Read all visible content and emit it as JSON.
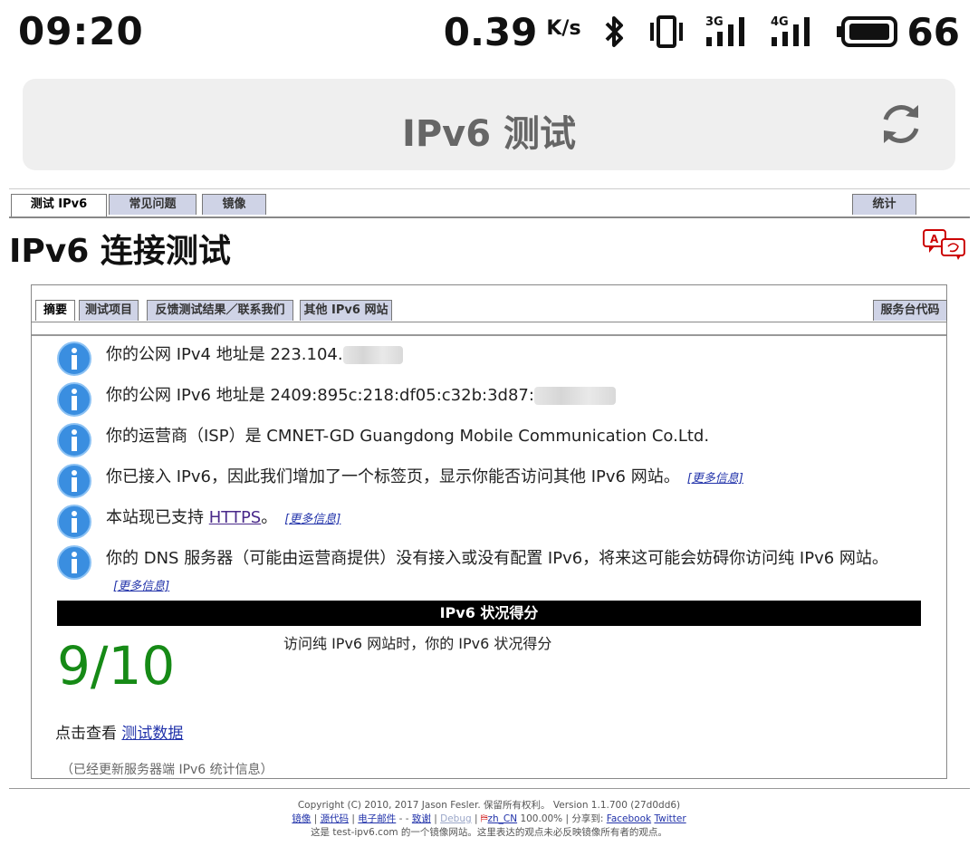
{
  "status_bar": {
    "time": "09:20",
    "speed": "0.39",
    "speed_unit": "K/s",
    "battery": "66",
    "icons": [
      "bluetooth-icon",
      "vibrate-icon",
      "signal-3g-icon",
      "signal-4g-icon",
      "battery-icon"
    ],
    "net_3g": "3G",
    "net_4g": "4G"
  },
  "browser": {
    "title": "IPv6 测试"
  },
  "top_tabs": {
    "test": "测试 IPv6",
    "faq": "常见问题",
    "mirror": "镜像",
    "stats": "统计"
  },
  "page": {
    "title": "IPv6 连接测试"
  },
  "inner_tabs": {
    "summary": "摘要",
    "tests": "测试项目",
    "feedback": "反馈测试结果／联系我们",
    "other_sites": "其他 IPv6 网站",
    "helpdesk": "服务台代码"
  },
  "info": {
    "ipv4_prefix": "你的公网 IPv4 地址是 223.104.",
    "ipv6_prefix": "你的公网 IPv6 地址是 2409:895c:218:df05:c32b:3d87:",
    "isp": "你的运营商（ISP）是 CMNET-GD Guangdong Mobile Communication Co.Ltd.",
    "ipv6_tab": "你已接入 IPv6，因此我们增加了一个标签页，显示你能否访问其他 IPv6 网站。",
    "https_prefix": "本站现已支持 ",
    "https_link": "HTTPS",
    "https_suffix": "。",
    "dns": "你的 DNS 服务器（可能由运营商提供）没有接入或没有配置 IPv6，将来这可能会妨碍你访问纯 IPv6 网站。",
    "more_info": "[更多信息]"
  },
  "score": {
    "header": "IPv6 状况得分",
    "value": "9/10",
    "description": "访问纯 IPv6 网站时，你的 IPv6 状况得分",
    "view_prefix": "点击查看 ",
    "view_link": "测试数据",
    "updated": "（已经更新服务器端 IPv6 统计信息）"
  },
  "footer": {
    "copyright": "Copyright (C) 2010, 2017 Jason Fesler. 保留所有权利。 Version 1.1.700 (27d0dd6)",
    "mirror": "镜像",
    "source": "源代码",
    "email": "电子邮件",
    "sep1": " - ",
    "thanks": "致谢",
    "debug": "Debug",
    "locale": "zh_CN",
    "percent": "100.00%",
    "share_label": "分享到:",
    "facebook": "Facebook",
    "twitter": "Twitter",
    "note": "这是 test-ipv6.com 的一个镜像网站。这里表达的观点未必反映镜像所有者的观点。"
  },
  "colors": {
    "score_green": "#168a16",
    "tab_bg": "#cfd3e6",
    "info_blue": "#3a8ee0"
  }
}
